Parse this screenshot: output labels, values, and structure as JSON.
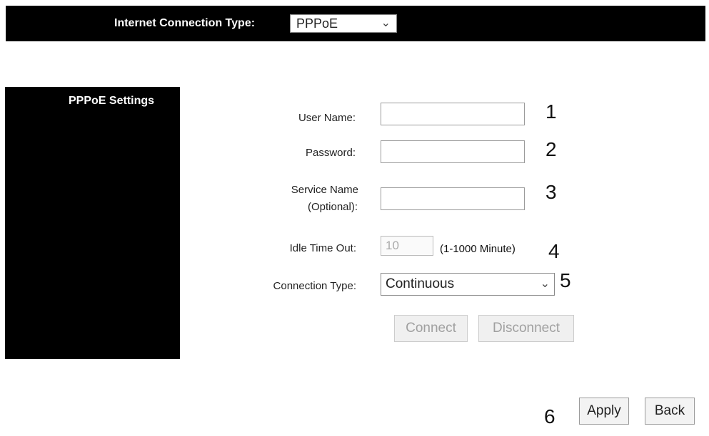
{
  "header": {
    "connection_type_label": "Internet Connection Type:",
    "connection_type_value": "PPPoE"
  },
  "sidebar": {
    "title": "PPPoE Settings"
  },
  "form": {
    "user_name_label": "User Name:",
    "user_name_value": "",
    "password_label": "Password:",
    "password_value": "",
    "service_name_label_line1": "Service Name",
    "service_name_label_line2": "(Optional):",
    "service_name_value": "",
    "idle_timeout_label": "Idle Time Out:",
    "idle_timeout_value": "10",
    "idle_timeout_unit": "(1-1000 Minute)",
    "connection_type_label": "Connection Type:",
    "connection_type_value": "Continuous",
    "connect_label": "Connect",
    "disconnect_label": "Disconnect"
  },
  "annotations": [
    "1",
    "2",
    "3",
    "4",
    "5",
    "6"
  ],
  "footer": {
    "apply_label": "Apply",
    "back_label": "Back"
  },
  "icons": {
    "dropdown": "chevron-down-icon"
  },
  "colors": {
    "panel_bg": "#000000",
    "disabled_text": "#a0a0a0"
  }
}
